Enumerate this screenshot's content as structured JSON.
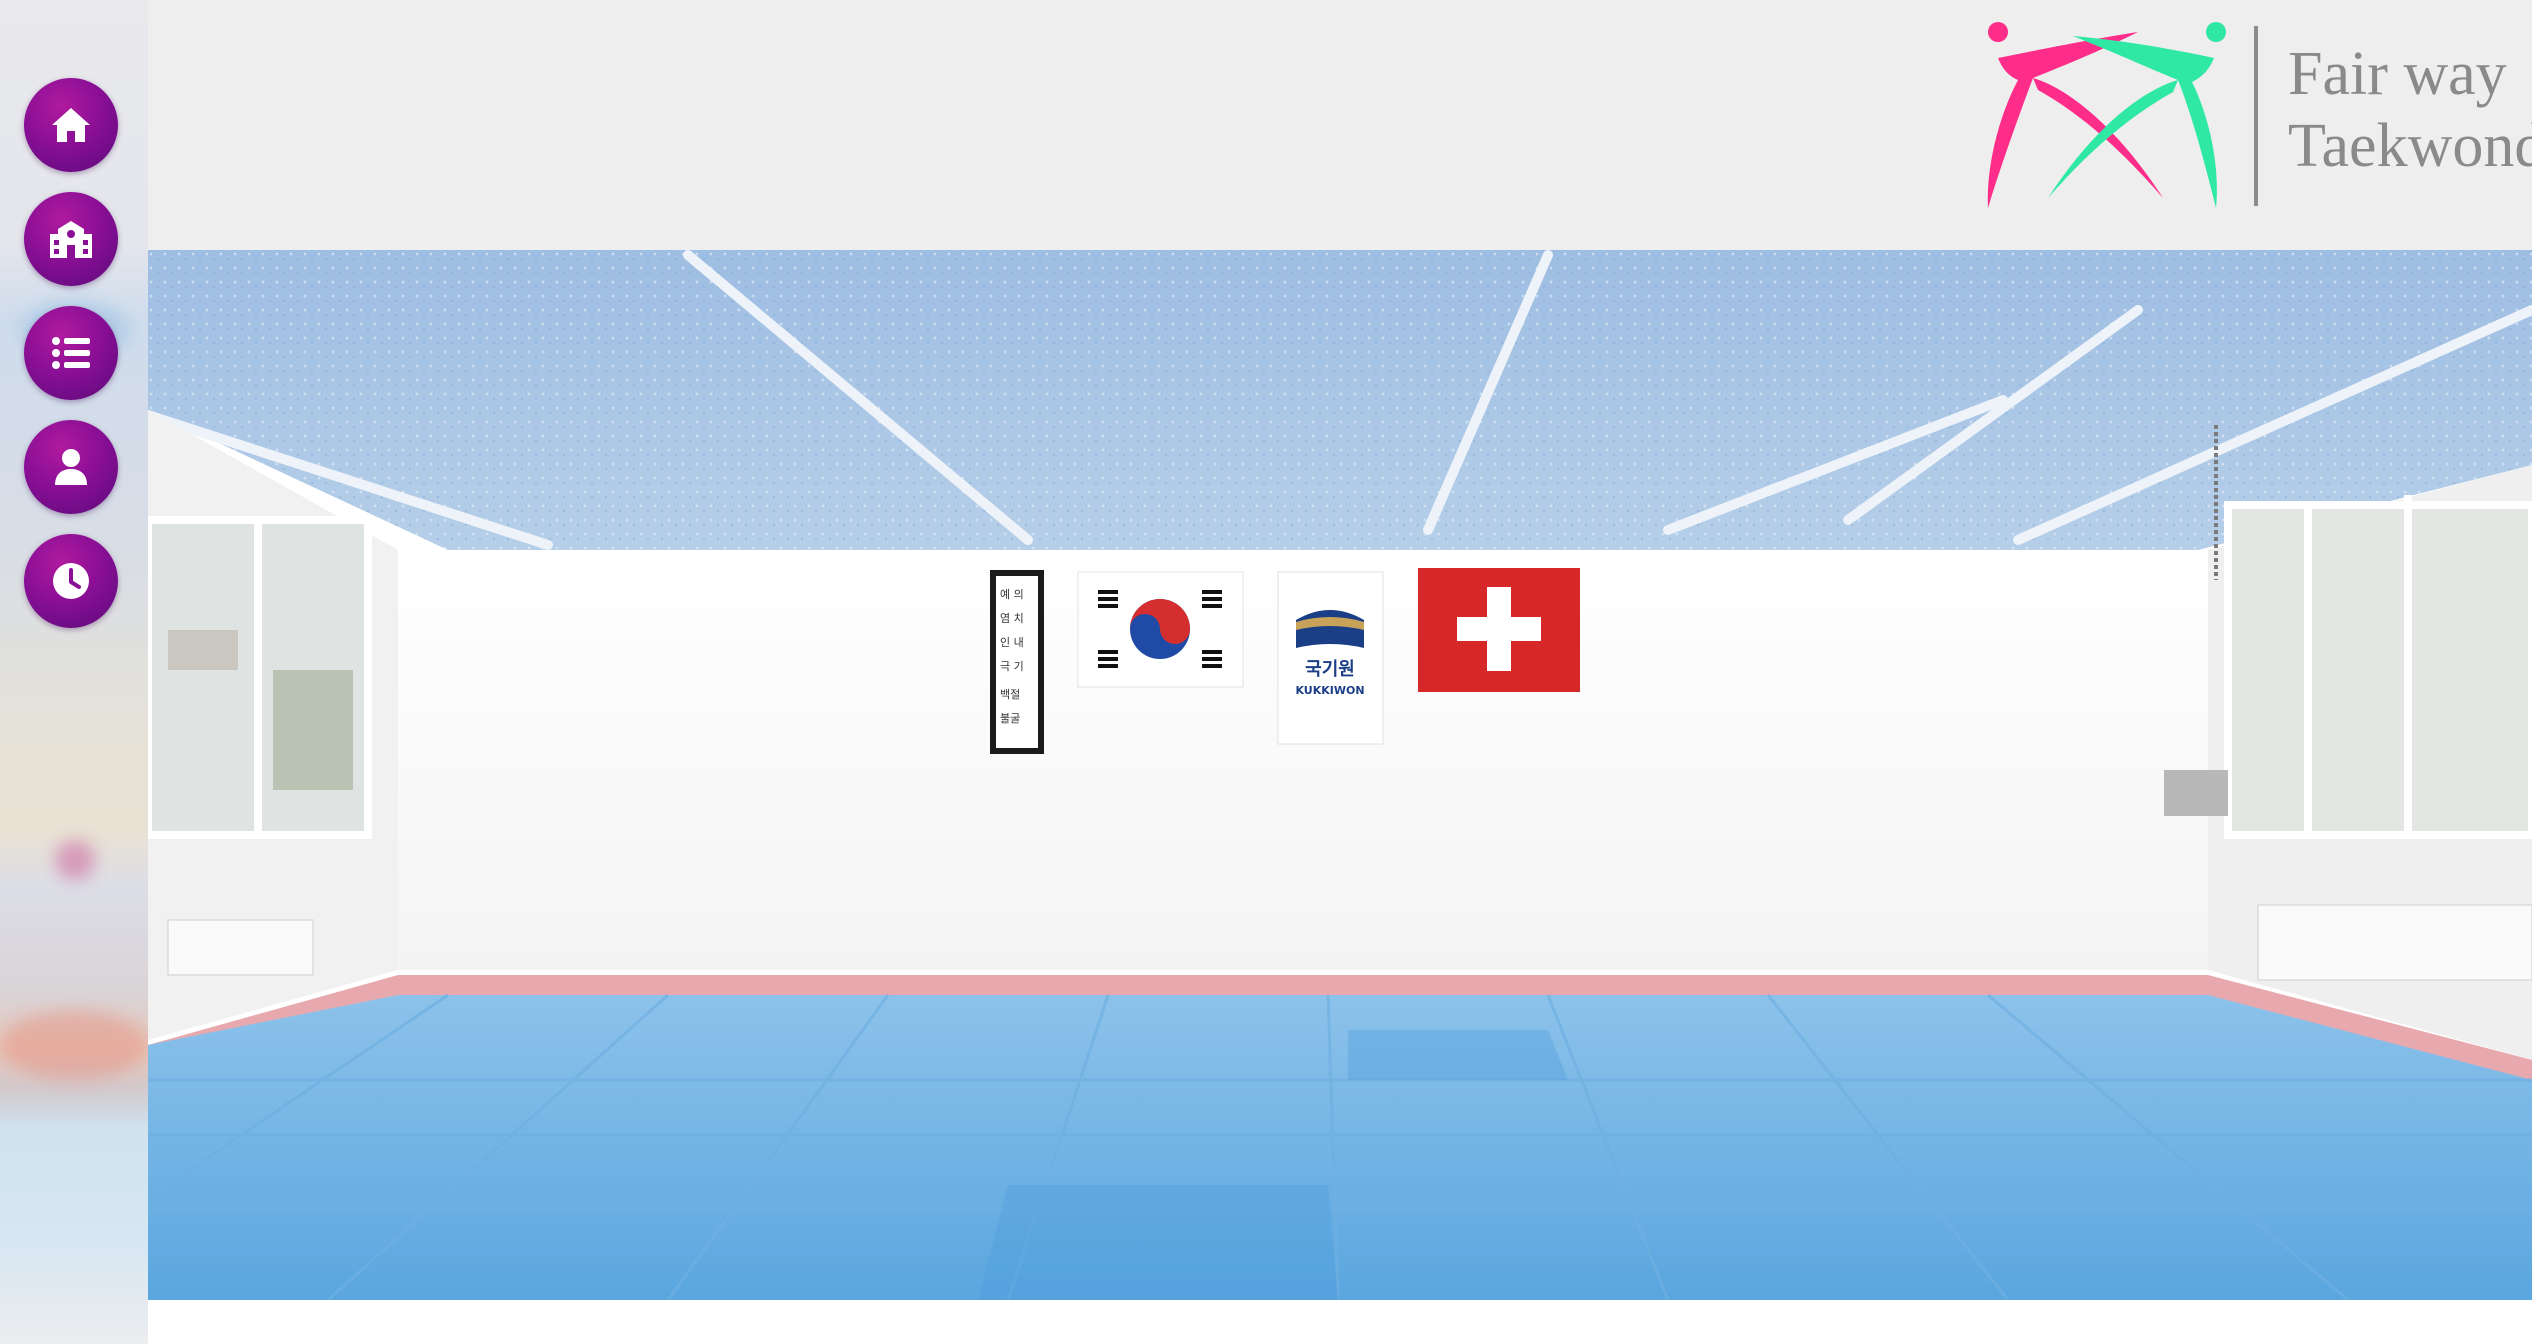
{
  "brand": {
    "line1": "Fair way",
    "line2": "Taekwondo",
    "mark_colors": {
      "pink": "#ff2d8a",
      "green": "#2ee8a4"
    },
    "text_color": "#8a8a8a"
  },
  "sidebar": {
    "items": [
      {
        "name": "home",
        "icon": "home-icon"
      },
      {
        "name": "school",
        "icon": "school-building-icon"
      },
      {
        "name": "list",
        "icon": "list-icon"
      },
      {
        "name": "profile",
        "icon": "user-icon"
      },
      {
        "name": "schedule",
        "icon": "clock-icon"
      }
    ],
    "button_color": "#8a0f95"
  },
  "hero": {
    "scene": "dojang",
    "calligraphy_lines": [
      "예의",
      "염치",
      "인내",
      "극기",
      "백절불굴"
    ],
    "banner_text": "국기원",
    "banner_caption": "KUKKIWON"
  },
  "colors": {
    "header_bg": "#eeeeee",
    "mat_blue": "#7fb7e3",
    "mat_red": "#e9a7ad",
    "wall": "#fbfbfb",
    "ceiling": "#a8c6e6"
  }
}
